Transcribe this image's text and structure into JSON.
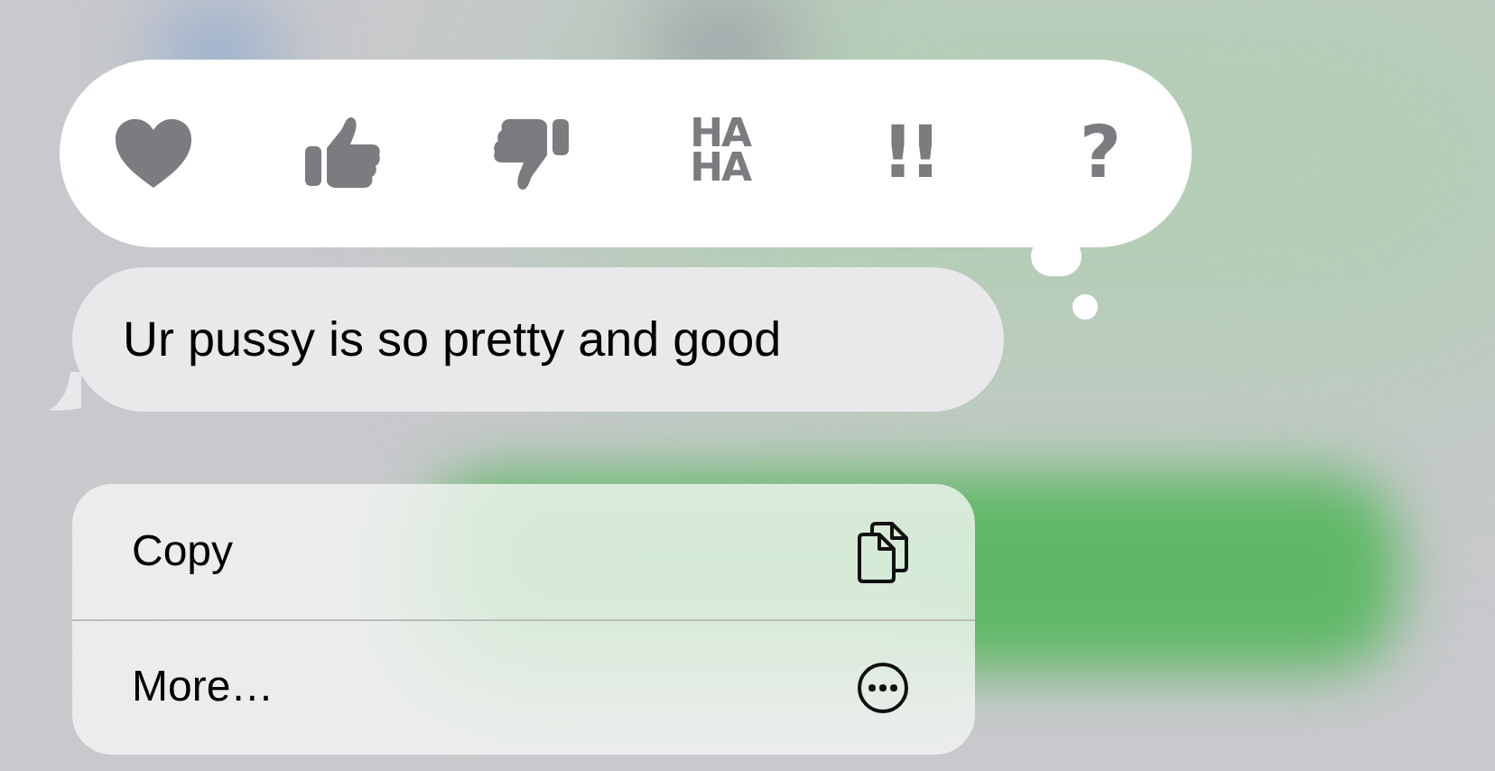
{
  "reactions": [
    {
      "kind": "heart"
    },
    {
      "kind": "thumbs-up"
    },
    {
      "kind": "thumbs-down"
    },
    {
      "kind": "text",
      "label": "HA HA"
    },
    {
      "kind": "text",
      "label": "!!"
    },
    {
      "kind": "text",
      "label": "?"
    }
  ],
  "message": {
    "text": "Ur pussy is so pretty and good"
  },
  "menu": [
    {
      "label": "Copy",
      "kind": "copy"
    },
    {
      "label": "More…",
      "kind": "more"
    }
  ]
}
